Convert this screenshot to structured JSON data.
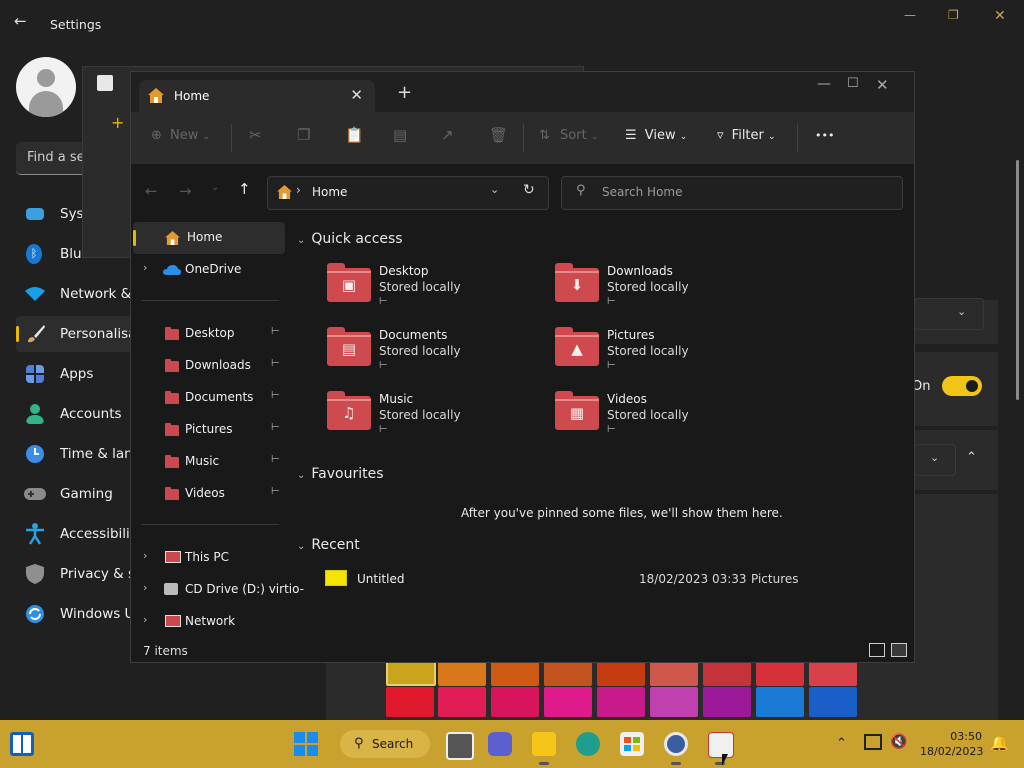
{
  "settings": {
    "title": "Settings",
    "search_placeholder": "Find a se",
    "nav": [
      {
        "label": "Syst",
        "icon": "system-icon",
        "color": "#3aa0e0"
      },
      {
        "label": "Bluetooth &",
        "icon": "bluetooth-icon",
        "color": "#1976d2"
      },
      {
        "label": "Network &",
        "icon": "wifi-icon",
        "color": "#1a9ee8"
      },
      {
        "label": "Personalisat",
        "icon": "brush-icon",
        "color": "#e0a060"
      },
      {
        "label": "Apps",
        "icon": "apps-icon",
        "color": "#4f7ed8"
      },
      {
        "label": "Accounts",
        "icon": "accounts-icon",
        "color": "#31b48a"
      },
      {
        "label": "Time & lang",
        "icon": "clock-icon",
        "color": "#3a8ee6"
      },
      {
        "label": "Gaming",
        "icon": "gamepad-icon",
        "color": "#8a8a8a"
      },
      {
        "label": "Accessibility",
        "icon": "accessibility-icon",
        "color": "#27a3e2"
      },
      {
        "label": "Privacy & s",
        "icon": "shield-icon",
        "color": "#8f8f8f"
      },
      {
        "label": "Windows U",
        "icon": "update-icon",
        "color": "#2f8fe0"
      }
    ],
    "toggle_label": "On"
  },
  "explorer": {
    "tab_title": "Home",
    "toolbar": {
      "new": "New",
      "sort": "Sort",
      "view": "View",
      "filter": "Filter",
      "more": "•••"
    },
    "address": "Home",
    "search_placeholder": "Search Home",
    "sidebar": {
      "home": "Home",
      "onedrive": "OneDrive",
      "pinned": [
        "Desktop",
        "Downloads",
        "Documents",
        "Pictures",
        "Music",
        "Videos"
      ],
      "this_pc": "This PC",
      "cd_drive": "CD Drive (D:) virtio-",
      "network": "Network"
    },
    "quick_access": {
      "heading": "Quick access",
      "items": [
        {
          "name": "Desktop",
          "sub": "Stored locally"
        },
        {
          "name": "Downloads",
          "sub": "Stored locally"
        },
        {
          "name": "Documents",
          "sub": "Stored locally"
        },
        {
          "name": "Pictures",
          "sub": "Stored locally"
        },
        {
          "name": "Music",
          "sub": "Stored locally"
        },
        {
          "name": "Videos",
          "sub": "Stored locally"
        }
      ]
    },
    "favourites": {
      "heading": "Favourites",
      "empty_text": "After you've pinned some files, we'll show them here."
    },
    "recent": {
      "heading": "Recent",
      "items": [
        {
          "name": "Untitled",
          "date": "18/02/2023 03:33",
          "location": "Pictures"
        }
      ]
    },
    "status": "7 items"
  },
  "taskbar": {
    "search_label": "Search",
    "time": "03:50",
    "date": "18/02/2023"
  }
}
